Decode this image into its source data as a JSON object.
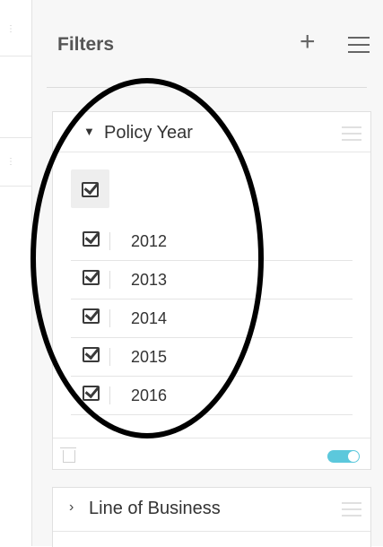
{
  "panel": {
    "title": "Filters",
    "add_icon": "plus-icon",
    "menu_icon": "hamburger-menu-icon"
  },
  "filters": [
    {
      "title": "Policy Year",
      "icon": "filter-funnel-icon",
      "select_all_checked": true,
      "items": [
        {
          "label": "2012",
          "checked": true
        },
        {
          "label": "2013",
          "checked": true
        },
        {
          "label": "2014",
          "checked": true
        },
        {
          "label": "2015",
          "checked": true
        },
        {
          "label": "2016",
          "checked": true
        }
      ],
      "toggle_on": true
    },
    {
      "title": "Line of Business",
      "icon": "chevron-right-icon"
    }
  ],
  "colors": {
    "panel_bg": "#f7f7f7",
    "toggle_accent": "#5cc8dc",
    "annotation": "#000000"
  }
}
